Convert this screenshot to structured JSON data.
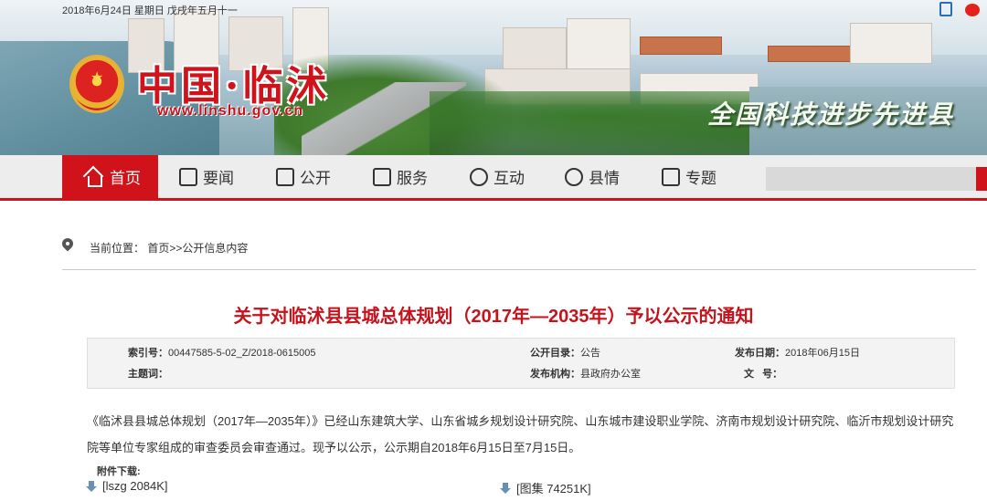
{
  "header": {
    "date_line": "2018年6月24日  星期日  戊戌年五月十一",
    "site_title": "中国·临沭",
    "site_url": "www.linshu.gov.cn",
    "slogan": "全国科技进步先进县"
  },
  "nav": {
    "items": [
      {
        "label": "首页",
        "icon": "home-icon",
        "active": true
      },
      {
        "label": "要闻",
        "icon": "news-icon"
      },
      {
        "label": "公开",
        "icon": "document-icon"
      },
      {
        "label": "服务",
        "icon": "computer-icon"
      },
      {
        "label": "互动",
        "icon": "chat-icon"
      },
      {
        "label": "县情",
        "icon": "star-icon"
      },
      {
        "label": "专题",
        "icon": "topic-icon"
      }
    ],
    "accent_color": "#d0121b"
  },
  "breadcrumb": {
    "text": "当前位置：  首页>>公开信息内容"
  },
  "article": {
    "title": "关于对临沭县县城总体规划（2017年—2035年）予以公示的通知",
    "meta": {
      "index_label": "索引号：",
      "index_value": "00447585-5-02_Z/2018-0615005",
      "catalog_label": "公开目录：",
      "catalog_value": "公告",
      "date_label": "发布日期：",
      "date_value": "2018年06月15日",
      "subject_label": "主题词：",
      "subject_value": "",
      "org_label": "发布机构：",
      "org_value": "县政府办公室",
      "docno_label": "文   号：",
      "docno_value": ""
    },
    "body": "《临沭县县城总体规划（2017年—2035年）》已经山东建筑大学、山东省城乡规划设计研究院、山东城市建设职业学院、济南市规划设计研究院、临沂市规划设计研究院等单位专家组成的审查委员会审查通过。现予以公示，公示期自2018年6月15日至7月15日。",
    "attachments_label": "附件下载:",
    "attachments": [
      {
        "label": "[lszg  2084K]"
      },
      {
        "label": "[图集  74251K]"
      }
    ]
  }
}
